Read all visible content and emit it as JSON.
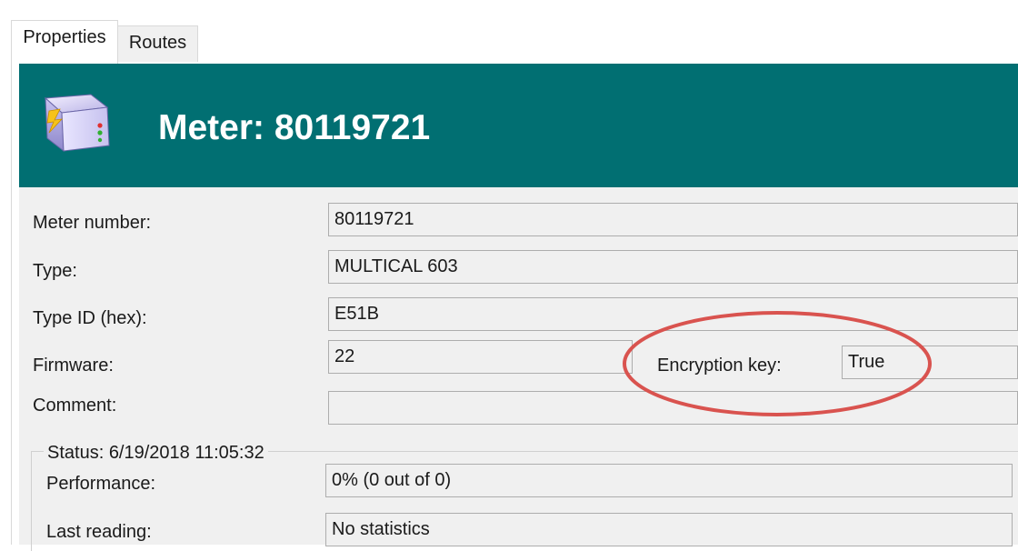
{
  "tabs": [
    {
      "label": "Properties",
      "active": true
    },
    {
      "label": "Routes",
      "active": false
    }
  ],
  "header": {
    "title": "Meter: 80119721",
    "icon": "meter-device-icon",
    "background_color": "#016f72"
  },
  "fields": {
    "meter_number": {
      "label": "Meter number:",
      "value": "80119721"
    },
    "type": {
      "label": "Type:",
      "value": "MULTICAL 603"
    },
    "type_id": {
      "label": "Type ID (hex):",
      "value": "E51B"
    },
    "firmware": {
      "label": "Firmware:",
      "value": "22"
    },
    "encryption_key": {
      "label": "Encryption key:",
      "value": "True"
    },
    "comment": {
      "label": "Comment:",
      "value": ""
    }
  },
  "status": {
    "legend": "Status: 6/19/2018 11:05:32",
    "performance": {
      "label": "Performance:",
      "value": "0% (0 out of 0)"
    },
    "last_reading": {
      "label": "Last reading:",
      "value": "No statistics"
    }
  },
  "annotation": {
    "shape": "ellipse",
    "color": "#d9534f"
  }
}
